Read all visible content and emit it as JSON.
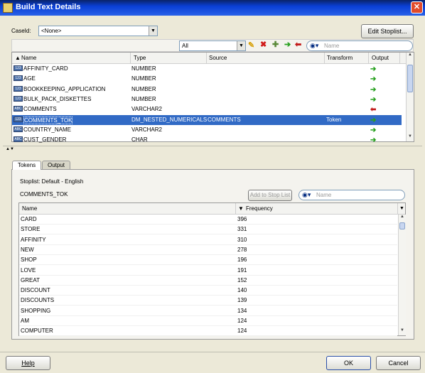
{
  "window": {
    "title": "Build Text Details",
    "close_glyph": "✕"
  },
  "caseid": {
    "label": "CaseId:",
    "value": "<None>"
  },
  "edit_stoplist_label": "Edit Stoplist...",
  "filter": {
    "value": "All"
  },
  "search_top": {
    "placeholder": "Name"
  },
  "columns_table": {
    "headers": {
      "name": "Name",
      "type": "Type",
      "source": "Source",
      "transform": "Transform",
      "output": "Output"
    },
    "rows": [
      {
        "icon": "123",
        "name": "AFFINITY_CARD",
        "type": "NUMBER",
        "source": "",
        "transform": "",
        "output": "green-arrow"
      },
      {
        "icon": "123",
        "name": "AGE",
        "type": "NUMBER",
        "source": "",
        "transform": "",
        "output": "green-arrow"
      },
      {
        "icon": "123",
        "name": "BOOKKEEPING_APPLICATION",
        "type": "NUMBER",
        "source": "",
        "transform": "",
        "output": "green-arrow"
      },
      {
        "icon": "123",
        "name": "BULK_PACK_DISKETTES",
        "type": "NUMBER",
        "source": "",
        "transform": "",
        "output": "green-arrow"
      },
      {
        "icon": "ABC",
        "name": "COMMENTS",
        "type": "VARCHAR2",
        "source": "",
        "transform": "",
        "output": "red-arrow"
      },
      {
        "icon": "123",
        "name": "COMMENTS_TOK",
        "type": "DM_NESTED_NUMERICALS",
        "source": "COMMENTS",
        "transform": "Token",
        "output": "green-arrow",
        "selected": true
      },
      {
        "icon": "ABC",
        "name": "COUNTRY_NAME",
        "type": "VARCHAR2",
        "source": "",
        "transform": "",
        "output": "green-arrow"
      },
      {
        "icon": "ABC",
        "name": "CUST_GENDER",
        "type": "CHAR",
        "source": "",
        "transform": "",
        "output": "green-arrow"
      }
    ]
  },
  "tabs": [
    {
      "label": "Tokens"
    },
    {
      "label": "Output"
    }
  ],
  "stoplist_label": "Stoplist:  Default - English",
  "token_field": {
    "value": "COMMENTS_TOK"
  },
  "add_stoplist_label": "Add to Stop List",
  "search_bottom": {
    "placeholder": "Name"
  },
  "tokens_table": {
    "headers": {
      "name": "Name",
      "frequency": "Frequency"
    },
    "rows": [
      {
        "name": "CARD",
        "frequency": "396"
      },
      {
        "name": "STORE",
        "frequency": "331"
      },
      {
        "name": "AFFINITY",
        "frequency": "310"
      },
      {
        "name": "NEW",
        "frequency": "278"
      },
      {
        "name": "SHOP",
        "frequency": "196"
      },
      {
        "name": "LOVE",
        "frequency": "191"
      },
      {
        "name": "GREAT",
        "frequency": "152"
      },
      {
        "name": "DISCOUNT",
        "frequency": "140"
      },
      {
        "name": "DISCOUNTS",
        "frequency": "139"
      },
      {
        "name": "SHOPPING",
        "frequency": "134"
      },
      {
        "name": "AM",
        "frequency": "124"
      },
      {
        "name": "COMPUTER",
        "frequency": "124"
      }
    ]
  },
  "buttons": {
    "help": "Help",
    "ok": "OK",
    "cancel": "Cancel"
  },
  "colors": {
    "selection": "#316ac5",
    "titlebar": "#0a3fd6",
    "dialog_bg": "#ece9d8"
  }
}
